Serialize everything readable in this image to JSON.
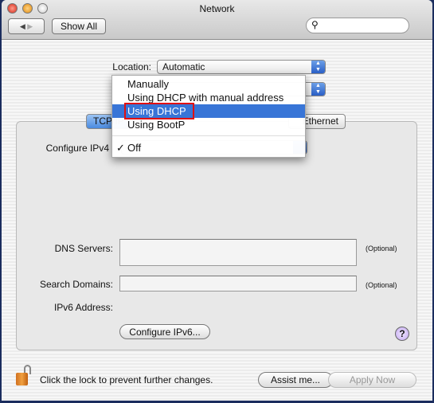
{
  "window": {
    "title": "Network"
  },
  "toolbar": {
    "back": "◀",
    "forward": "▶",
    "show_all": "Show All",
    "search_placeholder": ""
  },
  "location": {
    "label": "Location:",
    "value": "Automatic"
  },
  "show": {
    "value": ""
  },
  "tabs": [
    {
      "label": "TCP/IP",
      "selected": true
    },
    {
      "label": "Ethernet",
      "selected": false
    }
  ],
  "configure_ipv4": {
    "label": "Configure IPv4",
    "menu_items": [
      {
        "label": "Manually"
      },
      {
        "label": "Using DHCP with manual address"
      },
      {
        "label": "Using DHCP",
        "highlighted": true
      },
      {
        "label": "Using BootP"
      },
      {
        "label": "Off",
        "checked": true,
        "check": "✓"
      }
    ]
  },
  "dns": {
    "label": "DNS Servers:",
    "optional": "(Optional)",
    "value": ""
  },
  "search_domains": {
    "label": "Search Domains:",
    "optional": "(Optional)",
    "value": ""
  },
  "ipv6": {
    "label": "IPv6 Address:",
    "button": "Configure IPv6..."
  },
  "help": "?",
  "footer": {
    "lock_text": "Click the lock to prevent further changes.",
    "assist": "Assist me...",
    "apply": "Apply Now"
  },
  "colors": {
    "highlight": "#3875d7",
    "annotation": "#e01010",
    "frame": "#1b2d5e"
  }
}
